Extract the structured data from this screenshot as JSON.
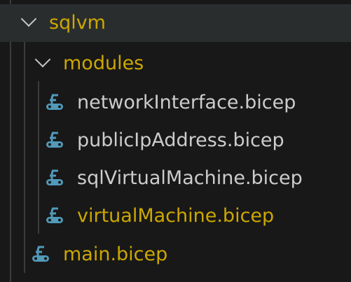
{
  "tree": {
    "root": {
      "label": "sqlvm",
      "expanded": true
    },
    "folder": {
      "label": "modules",
      "expanded": true
    },
    "files": [
      {
        "label": "networkInterface.bicep",
        "modified": false
      },
      {
        "label": "publicIpAddress.bicep",
        "modified": false
      },
      {
        "label": "sqlVirtualMachine.bicep",
        "modified": false
      },
      {
        "label": "virtualMachine.bicep",
        "modified": true
      }
    ],
    "main": {
      "label": "main.bicep",
      "modified": true
    }
  },
  "colors": {
    "modified": "#cca700",
    "normal": "#cccccc",
    "bicep_icon": "#519aba",
    "selection": "#2a2d2e"
  }
}
